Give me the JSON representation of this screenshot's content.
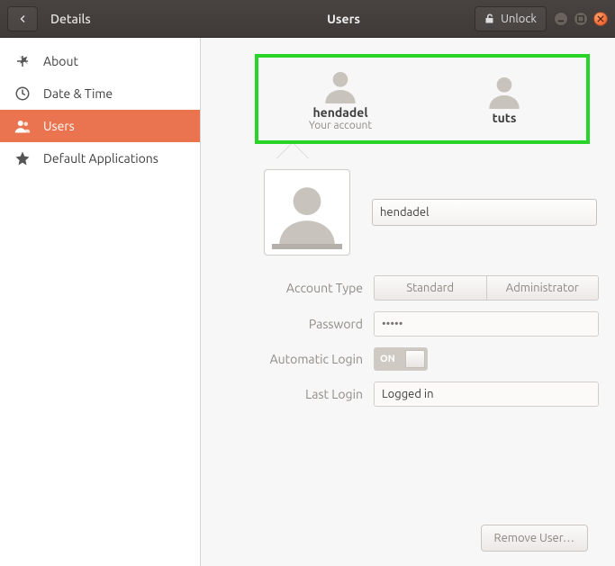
{
  "titlebar": {
    "back_section": "Details",
    "title": "Users",
    "unlock_label": "Unlock"
  },
  "sidebar": {
    "items": [
      {
        "id": "about",
        "label": "About",
        "icon": "plus-icon"
      },
      {
        "id": "datetime",
        "label": "Date & Time",
        "icon": "clock-icon"
      },
      {
        "id": "users",
        "label": "Users",
        "icon": "users-icon",
        "active": true
      },
      {
        "id": "defaultapps",
        "label": "Default Applications",
        "icon": "star-icon"
      }
    ]
  },
  "users_list": [
    {
      "name": "hendadel",
      "subtitle": "Your account"
    },
    {
      "name": "tuts",
      "subtitle": ""
    }
  ],
  "user_detail": {
    "name_value": "hendadel",
    "account_type_label": "Account Type",
    "account_type_options": [
      "Standard",
      "Administrator"
    ],
    "password_label": "Password",
    "password_value": "•••••",
    "auto_login_label": "Automatic Login",
    "auto_login_on": "ON",
    "last_login_label": "Last Login",
    "last_login_value": "Logged in"
  },
  "footer": {
    "remove_label": "Remove User…"
  },
  "annotation": {
    "highlight_color": "#27d427"
  }
}
